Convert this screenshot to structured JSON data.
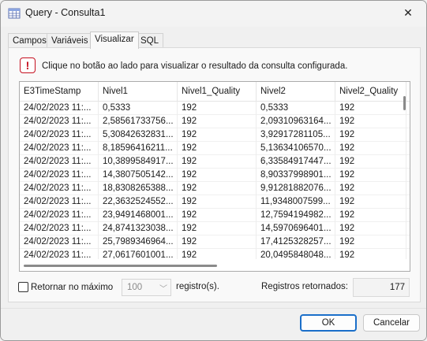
{
  "window": {
    "title": "Query - Consulta1"
  },
  "tabs": [
    {
      "label": "Campos",
      "active": false
    },
    {
      "label": "Variáveis",
      "active": false
    },
    {
      "label": "Visualizar",
      "active": true
    },
    {
      "label": "SQL",
      "active": false
    }
  ],
  "info": {
    "text": "Clique no botão ao lado para visualizar o resultado da consulta configurada."
  },
  "grid": {
    "columns": [
      "E3TimeStamp",
      "Nivel1",
      "Nivel1_Quality",
      "Nivel2",
      "Nivel2_Quality"
    ],
    "rows": [
      [
        "24/02/2023 11:...",
        "0,5333",
        "192",
        "0,5333",
        "192"
      ],
      [
        "24/02/2023 11:...",
        "2,58561733756...",
        "192",
        "2,09310963164...",
        "192"
      ],
      [
        "24/02/2023 11:...",
        "5,30842632831...",
        "192",
        "3,92917281105...",
        "192"
      ],
      [
        "24/02/2023 11:...",
        "8,18596416211...",
        "192",
        "5,13634106570...",
        "192"
      ],
      [
        "24/02/2023 11:...",
        "10,3899584917...",
        "192",
        "6,33584917447...",
        "192"
      ],
      [
        "24/02/2023 11:...",
        "14,3807505142...",
        "192",
        "8,90337998901...",
        "192"
      ],
      [
        "24/02/2023 11:...",
        "18,8308265388...",
        "192",
        "9,91281882076...",
        "192"
      ],
      [
        "24/02/2023 11:...",
        "22,3632524552...",
        "192",
        "11,9348007599...",
        "192"
      ],
      [
        "24/02/2023 11:...",
        "23,9491468001...",
        "192",
        "12,7594194982...",
        "192"
      ],
      [
        "24/02/2023 11:...",
        "24,8741323038...",
        "192",
        "14,5970696401...",
        "192"
      ],
      [
        "24/02/2023 11:...",
        "25,7989346964...",
        "192",
        "17,4125328257...",
        "192"
      ],
      [
        "24/02/2023 11:...",
        "27,0617601001...",
        "192",
        "20,0495848048...",
        "192"
      ]
    ]
  },
  "options": {
    "max_label": "Retornar no máximo",
    "max_value": "100",
    "registros_label": "registro(s).",
    "returned_label": "Registros retornados:",
    "returned_value": "177"
  },
  "buttons": {
    "ok": "OK",
    "cancel": "Cancelar"
  },
  "colors": {
    "accent": "#1b6fc9",
    "warning": "#c50f1f"
  }
}
